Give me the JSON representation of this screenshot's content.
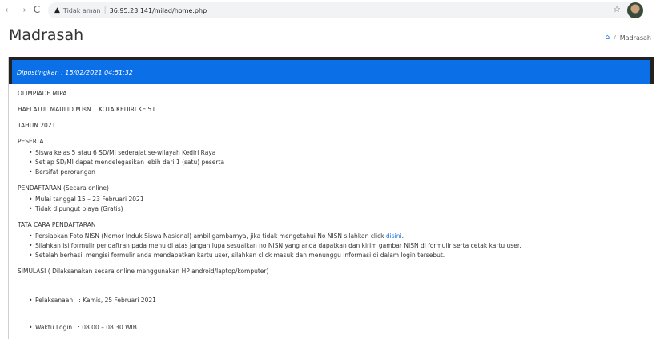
{
  "browser": {
    "back_icon": "←",
    "forward_icon": "→",
    "reload_icon": "C",
    "security_status": "Tidak aman",
    "url": "36.95.23.141/milad/home.php"
  },
  "header": {
    "title": "Madrasah",
    "breadcrumb_sep": "/",
    "breadcrumb_current": "Madrasah"
  },
  "post": {
    "date_line": "Dipostingkan : 15/02/2021 04:51:32",
    "title": "OLIMPIADE MIPA",
    "event": "HAFLATUL MAULID MTsN 1 KOTA KEDIRI KE 51",
    "year": "TAHUN 2021",
    "peserta_heading": "PESERTA",
    "peserta_items": [
      "Siswa kelas 5 atau 6 SD/MI sederajat se-wilayah Kediri Raya",
      "Setiap SD/MI dapat mendelegasikan lebih dari 1 (satu) peserta",
      "Bersifat perorangan"
    ],
    "pendaftaran_heading": "PENDAFTARAN (Secara online)",
    "pendaftaran_items": [
      "Mulai tanggal 15 – 23 Februari 2021",
      "Tidak dipungut biaya (Gratis)"
    ],
    "tata_cara_heading": "TATA CARA PENDAFTARAN",
    "tata_cara_item1": "Persiapkan Foto NISN (Nomor Induk Siswa Nasional) ambil gambarnya, jika tidak mengetahui No NISN silahkan click ",
    "tata_cara_link": "disini",
    "tata_cara_item1_end": ".",
    "tata_cara_item2": "Silahkan isi formulir pendaftran pada menu di atas jangan lupa sesuaikan no NISN yang anda dapatkan dan kirim gambar NISN di formulir serta  cetak kartu user.",
    "tata_cara_item3": "Setelah berhasil mengisi formulir anda mendapatkan kartu user, silahkan click masuk dan menunggu informasi di dalam login tersebut.",
    "simulasi_heading": "SIMULASI ( Dilaksanakan secara online menggunakan HP android/laptop/komputer)",
    "simulasi_items": [
      "Pelaksanaan   : Kamis, 25 Februari 2021",
      "Waktu Login   : 08.00 – 08.30 WIB"
    ]
  },
  "colors": {
    "post_header_bg": "#0b6fe8",
    "link": "#1a73e8"
  },
  "icons": {
    "warning": "warning-triangle-icon",
    "star": "star-icon",
    "home": "home-icon"
  }
}
